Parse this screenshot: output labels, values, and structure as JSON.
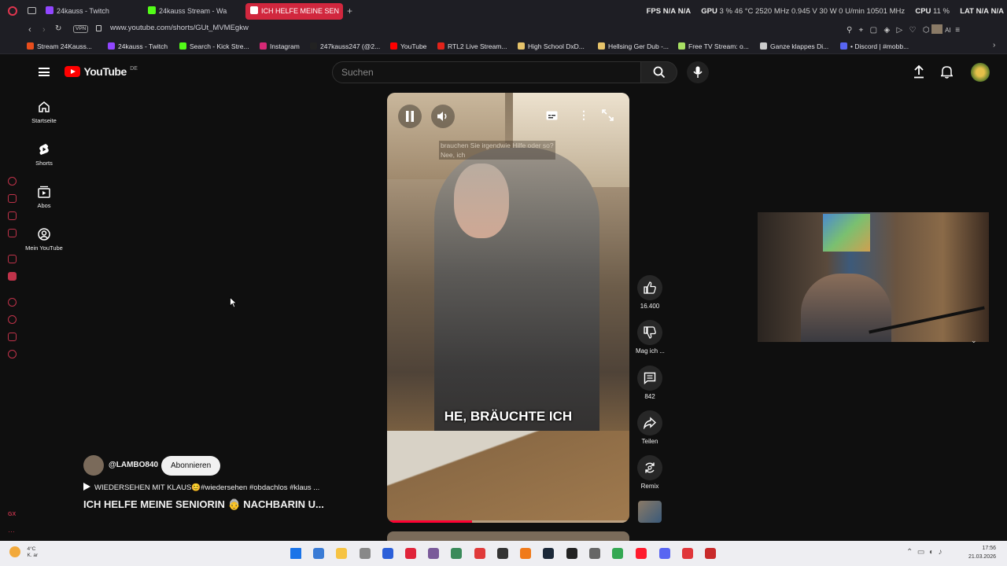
{
  "browser": {
    "tabs": [
      {
        "label": "24kauss - Twitch",
        "color": "#9146ff"
      },
      {
        "label": "24kauss Stream - Wa",
        "color": "#53fc18"
      },
      {
        "label": "ICH HELFE MEINE SEN",
        "color": "#ff0000"
      }
    ],
    "stats": {
      "fps_label": "FPS",
      "fps1": "N/A",
      "fps2": "N/A",
      "gpu_label": "GPU",
      "gpu_vals": "3 %  46 °C  2520 MHz  0.945 V  30 W  0 U/min  10501 MHz",
      "cpu_label": "CPU",
      "cpu_val": "11 %",
      "lat_label": "LAT",
      "lat1": "N/A",
      "lat2": "N/A"
    },
    "url": "www.youtube.com/shorts/GUt_MVMEgkw",
    "vpn": "VPN",
    "ai": "AI",
    "bookmarks": [
      {
        "label": "Stream 24Kauss...",
        "color": "#e84d1c"
      },
      {
        "label": "24kauss - Twitch",
        "color": "#9146ff"
      },
      {
        "label": "Search - Kick Stre...",
        "color": "#53fc18"
      },
      {
        "label": "Instagram",
        "color": "#d62976"
      },
      {
        "label": "247kauss247 (@2...",
        "color": "#222222"
      },
      {
        "label": "YouTube",
        "color": "#ff0000"
      },
      {
        "label": "RTL2 Live Stream...",
        "color": "#e2231a"
      },
      {
        "label": "High School DxD...",
        "color": "#e6c36a"
      },
      {
        "label": "Hellsing Ger Dub -...",
        "color": "#e6c36a"
      },
      {
        "label": "Free TV Stream: o...",
        "color": "#a8e063"
      },
      {
        "label": "Ganze klappes Di...",
        "color": "#cccccc"
      },
      {
        "label": "• Discord | #mobb...",
        "color": "#5865f2"
      }
    ]
  },
  "youtube": {
    "logo": "YouTube",
    "logo_country": "DE",
    "search_placeholder": "Suchen",
    "nav": [
      {
        "label": "Startseite",
        "icon": "home-icon"
      },
      {
        "label": "Shorts",
        "icon": "shorts-icon"
      },
      {
        "label": "Abos",
        "icon": "subscriptions-icon"
      },
      {
        "label": "Mein YouTube",
        "icon": "account-icon"
      }
    ]
  },
  "video": {
    "caption_line1": "brauchen Sie irgendwie Hilfe oder so?",
    "caption_line2": "Nee, ich",
    "subtitle": "HE, BRÄUCHTE ICH",
    "progress": 0.35
  },
  "actions": {
    "likes": "16.400",
    "dislike": "Mag ich ...",
    "comments": "842",
    "share": "Teilen",
    "remix": "Remix"
  },
  "channel": {
    "name": "@LAMBO840",
    "subscribe": "Abonnieren"
  },
  "description": "WIEDERSEHEN MIT KLAUS😊#wiedersehen #obdachlos #klaus ...",
  "title": "ICH HELFE MEINE SENIORIN 👵 NACHBARIN U...",
  "taskbar": {
    "weather": "4°C",
    "weather_sub": "K. ar",
    "time": "17:56",
    "date": "21.03.2026"
  }
}
